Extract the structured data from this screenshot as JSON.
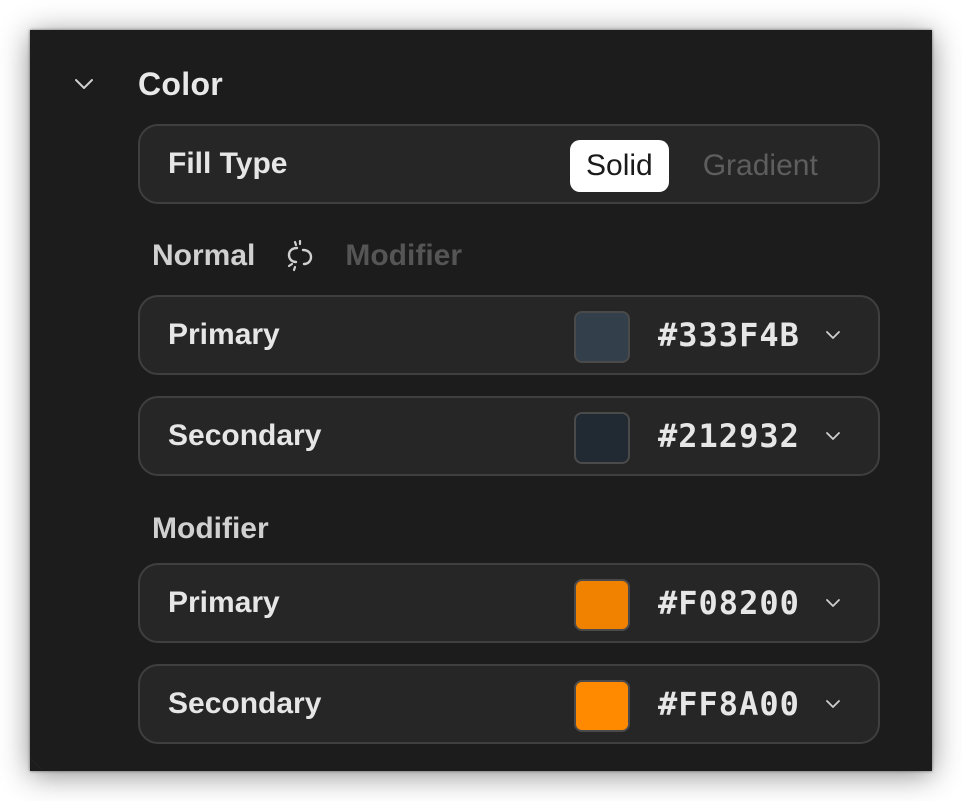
{
  "section": {
    "title": "Color",
    "collapse_icon": "chevron-down-icon"
  },
  "fill_type": {
    "label": "Fill Type",
    "options": [
      "Solid",
      "Gradient"
    ],
    "selected": "Solid"
  },
  "mode": {
    "normal_label": "Normal",
    "link_icon": "link-icon",
    "modifier_label": "Modifier"
  },
  "normal_colors": [
    {
      "label": "Primary",
      "hex": "#333F4B",
      "swatch": "#333f4b"
    },
    {
      "label": "Secondary",
      "hex": "#212932",
      "swatch": "#212932"
    }
  ],
  "modifier": {
    "heading": "Modifier",
    "colors": [
      {
        "label": "Primary",
        "hex": "#F08200",
        "swatch": "#f08200"
      },
      {
        "label": "Secondary",
        "hex": "#FF8A00",
        "swatch": "#ff8a00"
      }
    ]
  },
  "colors": {
    "panel_bg": "#1c1c1c",
    "row_bg": "#262626",
    "row_border": "#3f3f3f",
    "text": "#e6e6e6",
    "muted": "#555555"
  }
}
